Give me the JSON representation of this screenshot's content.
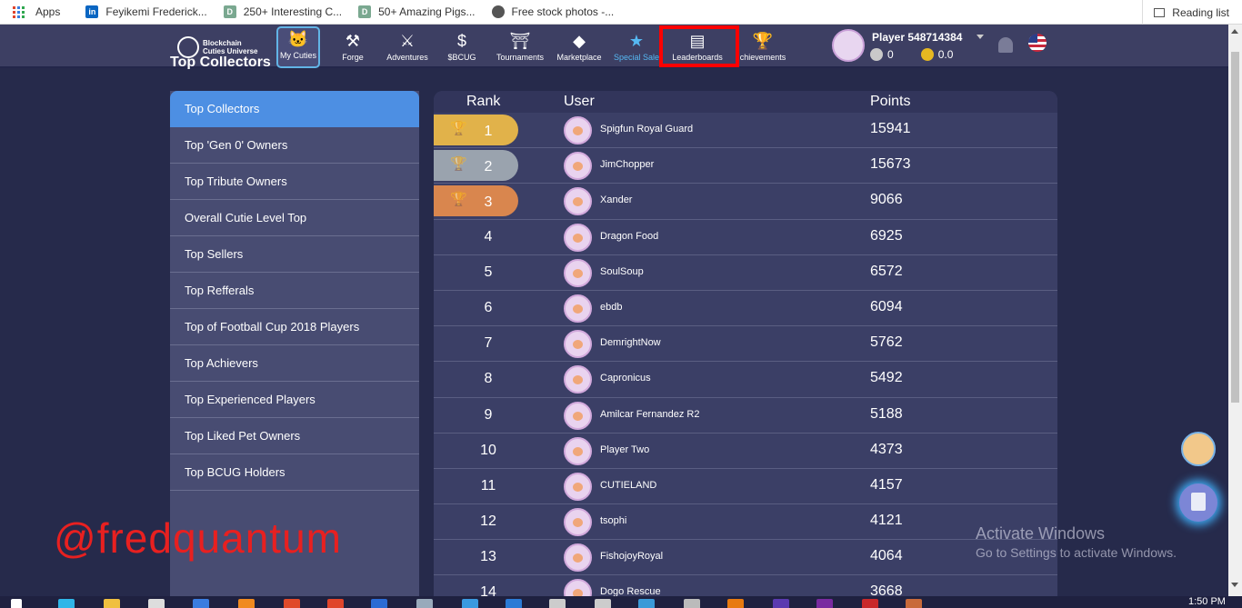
{
  "bookmarks": {
    "apps": "Apps",
    "items": [
      "Feyikemi Frederick...",
      "250+ Interesting C...",
      "50+ Amazing Pigs...",
      "Free stock photos -..."
    ],
    "reading_list": "Reading list"
  },
  "logo": {
    "line1": "Blockchain",
    "line2": "Cuties Universe"
  },
  "nav": [
    {
      "label": "My Cuties",
      "icon": "cat-face-icon"
    },
    {
      "label": "Forge",
      "icon": "anvil-icon"
    },
    {
      "label": "Adventures",
      "icon": "crossed-swords-icon"
    },
    {
      "label": "$BCUG",
      "icon": "dollar-chart-icon"
    },
    {
      "label": "Tournaments",
      "icon": "helmet-icon"
    },
    {
      "label": "Marketplace",
      "icon": "tag-icon"
    },
    {
      "label": "Special Sale",
      "icon": "star-icon"
    },
    {
      "label": "Leaderboards",
      "icon": "podium-icon"
    },
    {
      "label": "chievements",
      "icon": "trophy-icon"
    }
  ],
  "player": {
    "name": "Player 548714384",
    "gems": "0",
    "coins": "0.0"
  },
  "heading": "Top Collectors",
  "sidebar": [
    "Top Collectors",
    "Top 'Gen 0' Owners",
    "Top Tribute Owners",
    "Overall Cutie Level Top",
    "Top Sellers",
    "Top Refferals",
    "Top of Football Cup 2018 Players",
    "Top Achievers",
    "Top Experienced Players",
    "Top Liked Pet Owners",
    "Top BCUG Holders"
  ],
  "table": {
    "headers": {
      "rank": "Rank",
      "user": "User",
      "points": "Points"
    },
    "rows": [
      {
        "rank": "1",
        "user": "Spigfun Royal Guard",
        "points": "15941"
      },
      {
        "rank": "2",
        "user": "JimChopper",
        "points": "15673"
      },
      {
        "rank": "3",
        "user": "Xander",
        "points": "9066"
      },
      {
        "rank": "4",
        "user": "Dragon Food",
        "points": "6925"
      },
      {
        "rank": "5",
        "user": "SoulSoup",
        "points": "6572"
      },
      {
        "rank": "6",
        "user": "ebdb",
        "points": "6094"
      },
      {
        "rank": "7",
        "user": "DemrightNow",
        "points": "5762"
      },
      {
        "rank": "8",
        "user": "Capronicus",
        "points": "5492"
      },
      {
        "rank": "9",
        "user": "Amilcar Fernandez R2",
        "points": "5188"
      },
      {
        "rank": "10",
        "user": "Player Two",
        "points": "4373"
      },
      {
        "rank": "11",
        "user": "CUTIELAND",
        "points": "4157"
      },
      {
        "rank": "12",
        "user": "tsophi",
        "points": "4121"
      },
      {
        "rank": "13",
        "user": "FishojoyRoyal",
        "points": "4064"
      },
      {
        "rank": "14",
        "user": "Dogo Rescue",
        "points": "3668"
      }
    ]
  },
  "overlay_tag": "@fredquantum",
  "activate": {
    "line1": "Activate Windows",
    "line2": "Go to Settings to activate Windows."
  },
  "clock": "1:50 PM",
  "colors": {
    "gold": "#e1b24a",
    "silver": "#9aa3ae",
    "bronze": "#d9864e",
    "accent": "#4d8fe3",
    "highlight": "#ff0000"
  }
}
